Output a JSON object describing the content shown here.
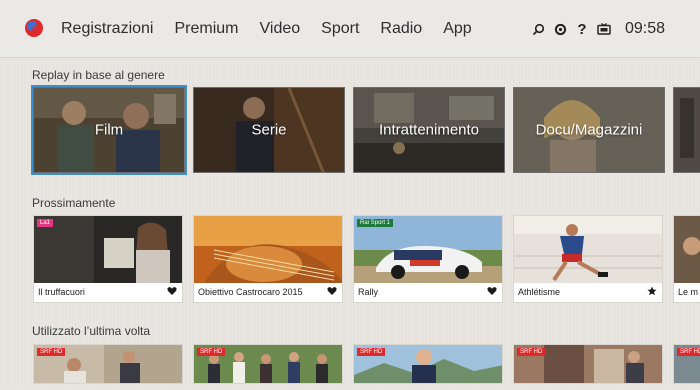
{
  "nav": {
    "items": [
      "Registrazioni",
      "Premium",
      "Video",
      "Sport",
      "Radio",
      "App"
    ]
  },
  "header_icons": [
    "search-icon",
    "settings-icon",
    "help-icon",
    "tv-icon"
  ],
  "clock": "09:58",
  "sections": {
    "genres_title": "Replay in base al genere",
    "upcoming_title": "Prossimamente",
    "recent_title": "Utilizzato l’ultima volta"
  },
  "genres": [
    "Film",
    "Serie",
    "Intrattenimento",
    "Docu/Magazzini"
  ],
  "upcoming": [
    {
      "caption": "Il truffacuori",
      "mark": "heart-icon",
      "badge": "La1"
    },
    {
      "caption": "Obiettivo Castrocaro 2015",
      "mark": "heart-icon",
      "badge": ""
    },
    {
      "caption": "Rally",
      "mark": "heart-icon",
      "badge": "Rai Sport 1"
    },
    {
      "caption": "Athlétisme",
      "mark": "star-icon",
      "badge": ""
    },
    {
      "caption": "Le m",
      "mark": "",
      "badge": ""
    }
  ],
  "recent_badges": [
    "SRF HD",
    "SRF HD",
    "SRF HD",
    "SRF HD",
    "SRF HD"
  ],
  "colors": {
    "accent": "#e0292b",
    "selection": "#3a8fd0",
    "background": "#e9e6e1"
  }
}
